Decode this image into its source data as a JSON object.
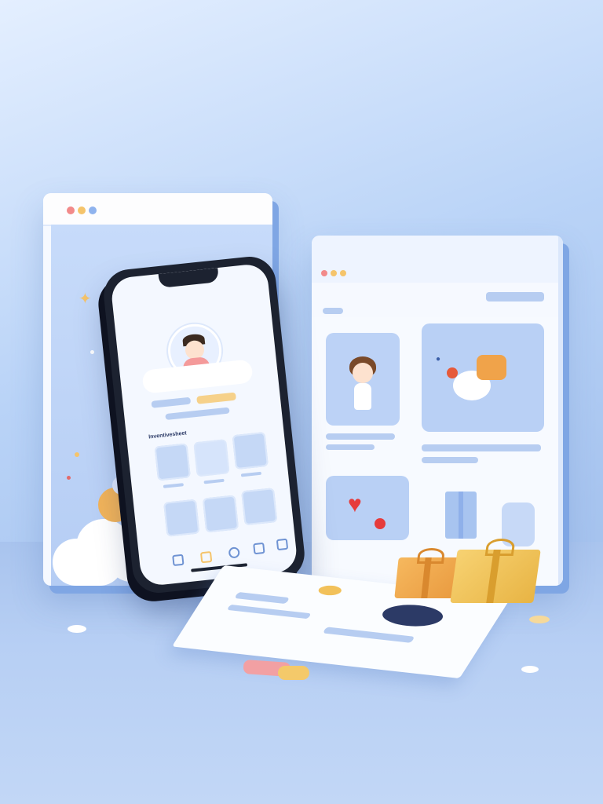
{
  "phone": {
    "section_title": "Inventivesheet"
  },
  "icons": {
    "star": "sparkle-star-icon",
    "gift": "gift-box-icon",
    "heart": "heart-icon"
  },
  "colors": {
    "traffic_red": "#f28a8a",
    "traffic_yellow": "#f5c46b",
    "traffic_blue": "#8fb3ee",
    "accent_gold": "#f2c15a",
    "accent_orange": "#f0a34a",
    "accent_blue": "#7fa6e4"
  }
}
